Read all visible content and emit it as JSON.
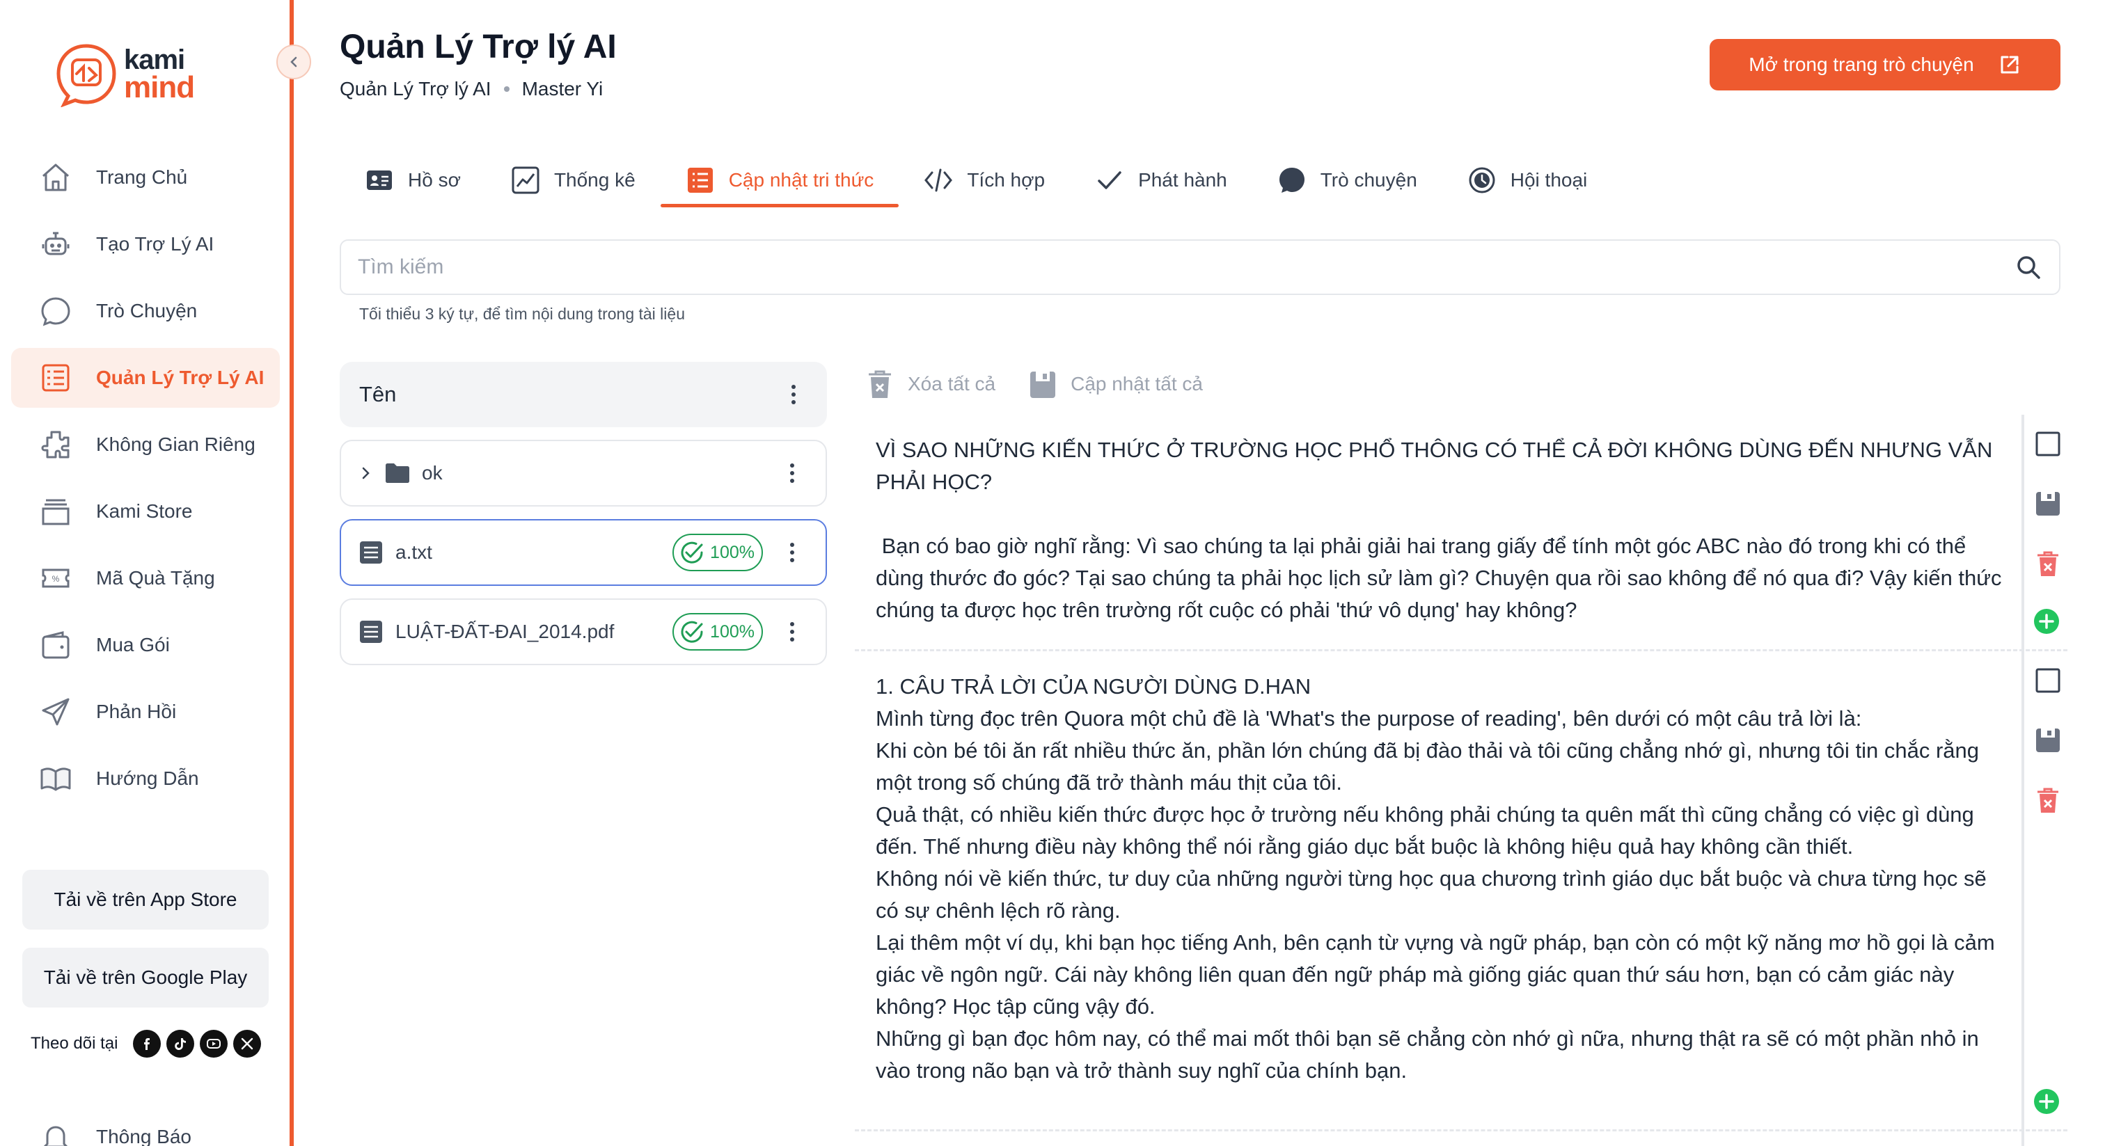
{
  "brand": {
    "line1": "kami",
    "line2": "mind",
    "accent_color": "#ee5a2f"
  },
  "sidebar": {
    "items": [
      {
        "label": "Trang Chủ",
        "icon": "home-icon"
      },
      {
        "label": "Tạo Trợ Lý AI",
        "icon": "robot-icon"
      },
      {
        "label": "Trò Chuyện",
        "icon": "chat-bubble-icon"
      },
      {
        "label": "Quản Lý Trợ Lý AI",
        "icon": "list-icon",
        "active": true
      },
      {
        "label": "Không Gian Riêng",
        "icon": "puzzle-icon"
      },
      {
        "label": "Kami Store",
        "icon": "store-icon"
      },
      {
        "label": "Mã Quà Tặng",
        "icon": "coupon-icon"
      },
      {
        "label": "Mua Gói",
        "icon": "wallet-icon"
      },
      {
        "label": "Phản Hồi",
        "icon": "send-icon"
      },
      {
        "label": "Hướng Dẫn",
        "icon": "book-icon"
      }
    ],
    "app_store": "Tải về trên App Store",
    "google_play": "Tải về trên Google Play",
    "follow_label": "Theo dõi tại",
    "notifications": "Thông Báo"
  },
  "header": {
    "title": "Quản Lý Trợ lý AI",
    "breadcrumb": [
      "Quản Lý Trợ lý AI",
      "Master Yi"
    ],
    "open_chat_label": "Mở trong trang trò chuyện"
  },
  "tabs": [
    {
      "label": "Hồ sơ",
      "icon": "profile-card-icon"
    },
    {
      "label": "Thống kê",
      "icon": "chart-icon"
    },
    {
      "label": "Cập nhật tri thức",
      "icon": "knowledge-icon",
      "active": true
    },
    {
      "label": "Tích hợp",
      "icon": "code-icon"
    },
    {
      "label": "Phát hành",
      "icon": "check-icon"
    },
    {
      "label": "Trò chuyện",
      "icon": "chat-icon"
    },
    {
      "label": "Hội thoại",
      "icon": "history-icon"
    }
  ],
  "search": {
    "placeholder": "Tìm kiếm",
    "hint": "Tối thiểu 3 ký tự, để tìm nội dung trong tài liệu"
  },
  "files": {
    "header": "Tên",
    "rows": [
      {
        "name": "ok",
        "type": "folder"
      },
      {
        "name": "a.txt",
        "type": "file",
        "progress": "100%",
        "selected": true
      },
      {
        "name": "LUẬT-ĐẤT-ĐAI_2014.pdf",
        "type": "file",
        "progress": "100%"
      }
    ]
  },
  "content_actions": {
    "delete_all": "Xóa tất cả",
    "update_all": "Cập nhật tất cả"
  },
  "chunks": [
    "VÌ SAO NHỮNG KIẾN THỨC Ở TRƯỜNG HỌC PHỔ THÔNG CÓ THỂ CẢ ĐỜI KHÔNG DÙNG ĐẾN NHƯNG VẪN PHẢI HỌC?\n\n Bạn có bao giờ nghĩ rằng: Vì sao chúng ta lại phải giải hai trang giấy để tính một góc ABC nào đó trong khi có thể dùng thước đo góc? Tại sao chúng ta phải học lịch sử làm gì? Chuyện qua rồi sao không để nó qua đi? Vậy kiến thức chúng ta được học trên trường rốt cuộc có phải 'thứ vô dụng' hay không?",
    "1. CÂU TRẢ LỜI CỦA NGƯỜI DÙNG D.HAN\nMình từng đọc trên Quora một chủ đề là 'What's the purpose of reading', bên dưới có một câu trả lời là:\nKhi còn bé tôi ăn rất nhiều thức ăn, phần lớn chúng đã bị đào thải và tôi cũng chẳng nhớ gì, nhưng tôi tin chắc rằng một trong số chúng đã trở thành máu thịt của tôi.\nQuả thật, có nhiều kiến thức được học ở trường nếu không phải chúng ta quên mất thì cũng chẳng có việc gì dùng đến. Thế nhưng điều này không thể nói rằng giáo dục bắt buộc là không hiệu quả hay không cần thiết.\nKhông nói về kiến thức, tư duy của những người từng học qua chương trình giáo dục bắt buộc và chưa từng học sẽ có sự chênh lệch rõ ràng.\nLại thêm một ví dụ, khi bạn học tiếng Anh, bên cạnh từ vựng và ngữ pháp, bạn còn có một kỹ năng mơ hồ gọi là cảm giác về ngôn ngữ. Cái này không liên quan đến ngữ pháp mà giống giác quan thứ sáu hơn, bạn có cảm giác này không? Học tập cũng vậy đó.\nNhững gì bạn đọc hôm nay, có thể mai mốt thôi bạn sẽ chẳng còn nhớ gì nữa, nhưng thật ra sẽ có một phần nhỏ in vào trong não bạn và trở thành suy nghĩ của chính bạn."
  ]
}
